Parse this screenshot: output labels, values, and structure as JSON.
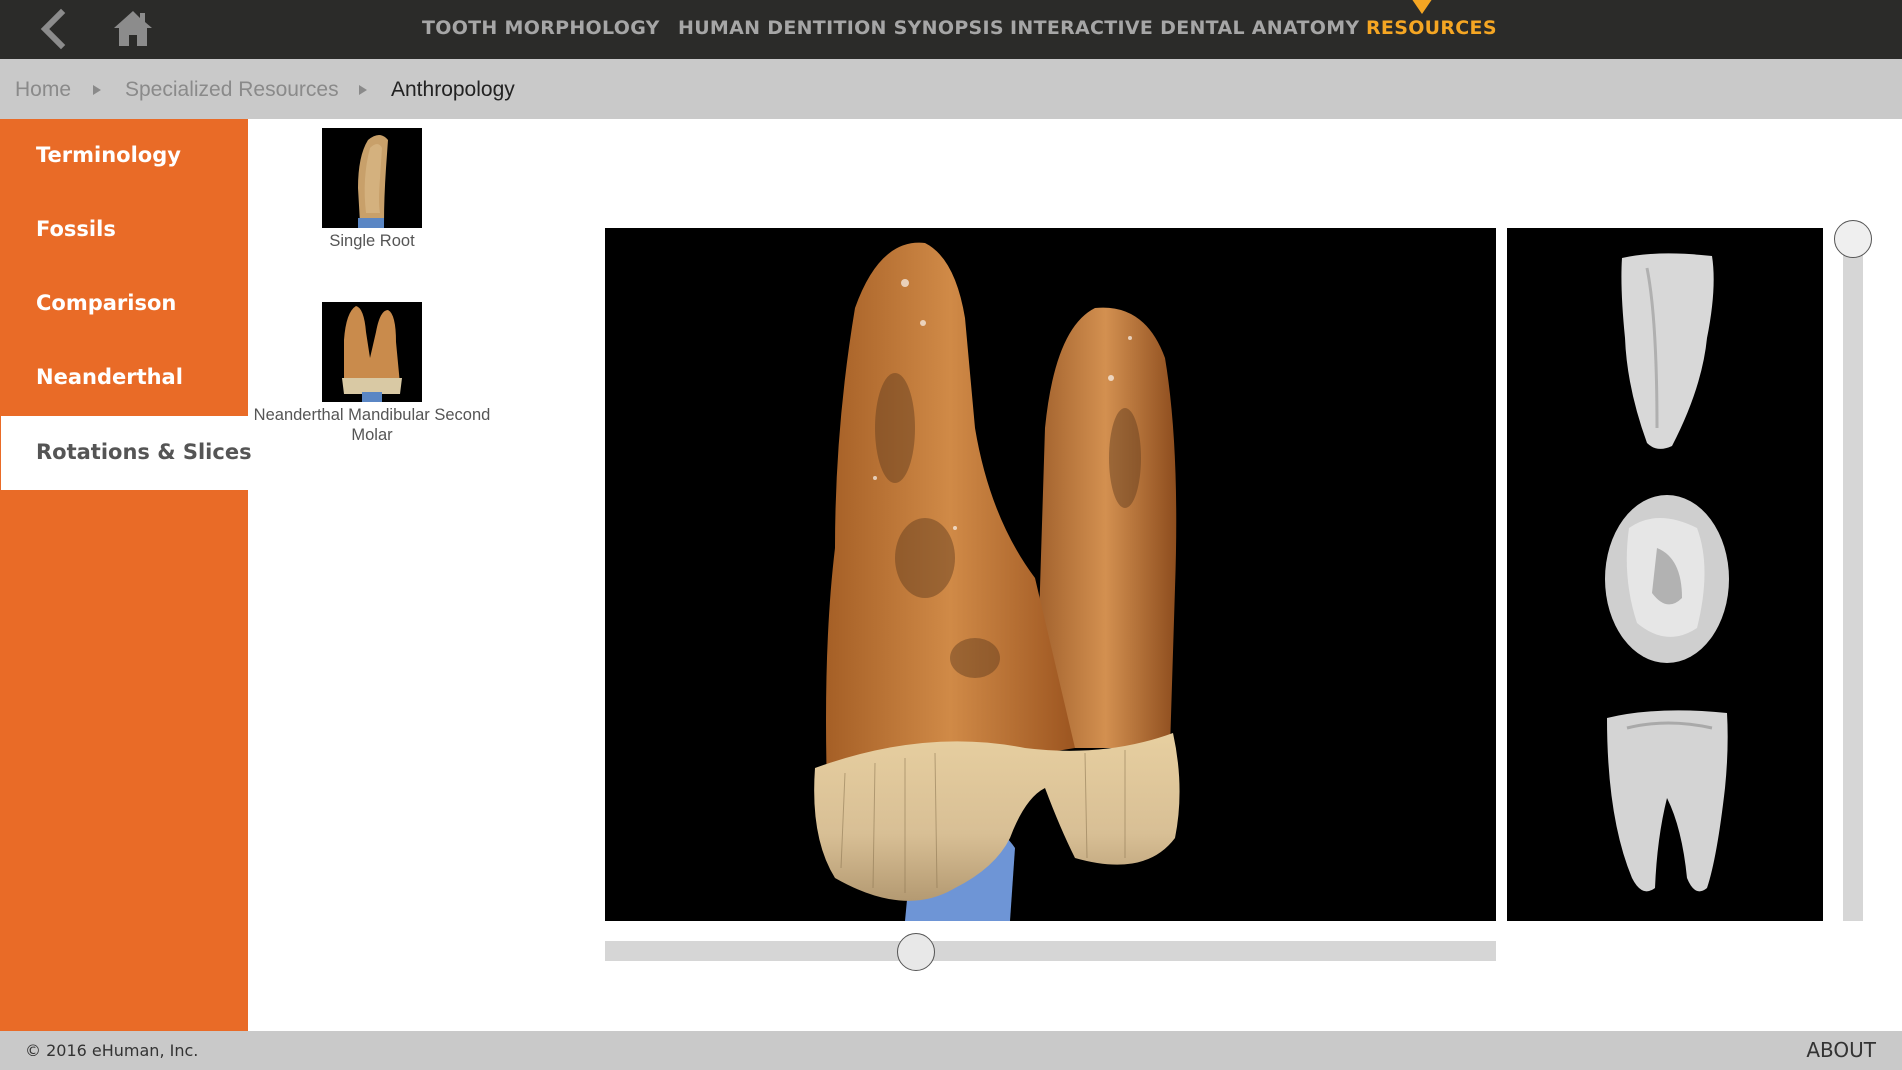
{
  "nav": {
    "back_icon": "back-arrow-icon",
    "home_icon": "home-icon",
    "links": [
      {
        "label": "TOOTH MORPHOLOGY",
        "active": false
      },
      {
        "label": "HUMAN DENTITION SYNOPSIS",
        "active": false
      },
      {
        "label": "INTERACTIVE DENTAL ANATOMY",
        "active": false
      },
      {
        "label": "RESOURCES",
        "active": true
      }
    ],
    "active_color": "#f5a623"
  },
  "breadcrumb": [
    "Home",
    "Specialized Resources",
    "Anthropology"
  ],
  "sidebar": {
    "color": "#e96b27",
    "items": [
      {
        "label": "Terminology",
        "selected": false
      },
      {
        "label": "Fossils",
        "selected": false
      },
      {
        "label": "Comparison",
        "selected": false
      },
      {
        "label": "Neanderthal",
        "selected": false
      },
      {
        "label": "Rotations & Slices",
        "selected": true
      }
    ]
  },
  "thumbnails": [
    {
      "label": "Single Root"
    },
    {
      "label": "Neanderthal Mandibular Second Molar"
    }
  ],
  "viewer": {
    "rotation_slider": 0.35,
    "slice_slider": 0.0
  },
  "footer": {
    "copyright": "© 2016 eHuman, Inc.",
    "about": "ABOUT"
  }
}
